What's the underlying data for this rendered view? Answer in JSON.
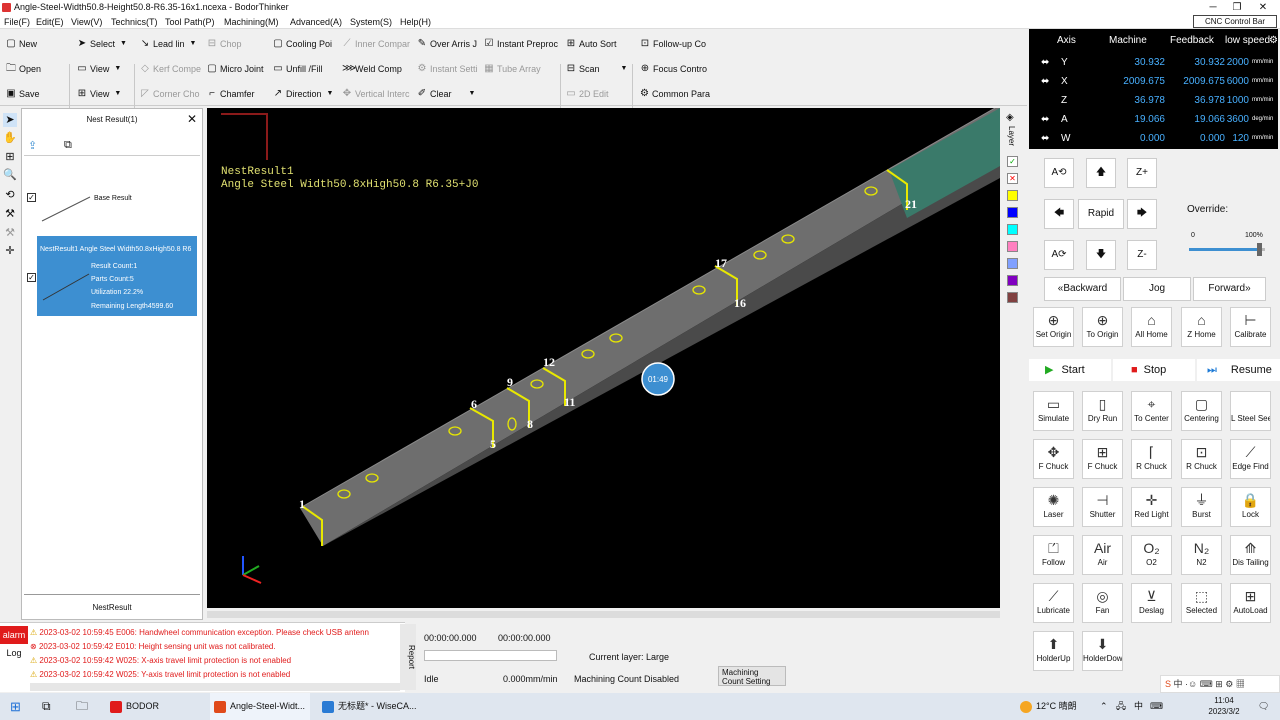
{
  "window": {
    "title": "Angle-Steel-Width50.8-Height50.8-R6.35-16x1.ncexa - BodorThinker"
  },
  "menu": [
    "File(F)",
    "Edit(E)",
    "View(V)",
    "Technics(T)",
    "Tool Path(P)",
    "Machining(M)",
    "Advanced(A)",
    "System(S)",
    "Help(H)"
  ],
  "cnc_bar": "CNC Control Bar",
  "toolbar": {
    "new": "New",
    "open": "Open",
    "save": "Save",
    "select": "Select",
    "view1": "View",
    "view2": "View",
    "lead_line": "Lead lin",
    "kerf_comp": "Kerf Compe",
    "corner_cho": "Corner Cho",
    "chop": "Chop",
    "micro_joint": "Micro Joint",
    "chamfer": "Chamfer",
    "cooling_point": "Cooling Poi",
    "unfill": "Unfill /Fill",
    "direction": "Direction",
    "inner_comp": "Inner Compar",
    "weld_comp": "Weld Comp",
    "vertical_inter": "Vertical Interc",
    "over_arris": "Over Arris J",
    "instant_sett": "Instant Setti",
    "clear": "Clear",
    "instant_preproc": "Instant Preproc",
    "tube_array": "Tube Array",
    "auto_sort": "Auto Sort",
    "scan": "Scan",
    "edit_2d": "2D Edit",
    "follow_up": "Follow-up Co",
    "focus_control": "Focus Contro",
    "common_para": "Common Para"
  },
  "nest_panel": {
    "title": "Nest Result(1)",
    "base_result": "Base Result",
    "result_title": "NestResult1 Angle Steel Width50.8xHigh50.8 R6",
    "result_count": "Result Count:1",
    "parts_count": "Parts Count:5",
    "utilization": "Utilization 22.2%",
    "remaining": "Remaining Length4599.60",
    "footer": "NestResult"
  },
  "canvas": {
    "label1": "NestResult1",
    "label2": "Angle Steel Width50.8xHigh50.8 R6.35+J0",
    "timer": "01:49",
    "part_numbers": [
      "1",
      "5",
      "6",
      "8",
      "9",
      "11",
      "12",
      "16",
      "17",
      "21"
    ]
  },
  "layer_label": "Layer",
  "layer_colors": [
    "#00aa00",
    "#ff0000",
    "#ffff00",
    "#0000ff",
    "#00ffff",
    "#ff80c0",
    "#80a0ff",
    "#8000c0",
    "#804040"
  ],
  "axis": {
    "headers": {
      "axis": "Axis",
      "machine": "Machine",
      "feedback": "Feedback",
      "speed": "low speed"
    },
    "rows": [
      {
        "name": "Y",
        "machine": "30.932",
        "feedback": "30.932",
        "speed": "2000",
        "unit": "mm/min"
      },
      {
        "name": "X",
        "machine": "2009.675",
        "feedback": "2009.675",
        "speed": "6000",
        "unit": "mm/min"
      },
      {
        "name": "Z",
        "machine": "36.978",
        "feedback": "36.978",
        "speed": "1000",
        "unit": "mm/min"
      },
      {
        "name": "A",
        "machine": "19.066",
        "feedback": "19.066",
        "speed": "3600",
        "unit": "deg/min"
      },
      {
        "name": "W",
        "machine": "0.000",
        "feedback": "0.000",
        "speed": "120",
        "unit": "mm/min"
      }
    ]
  },
  "jog": {
    "a_ccw": "A⟲",
    "z_plus": "Z+",
    "rapid": "Rapid",
    "a_cw": "A⟳",
    "z_minus": "Z-",
    "override_label": "Override:",
    "override_min": "0",
    "override_max": "100%",
    "override_value": 0.92
  },
  "move": {
    "backward": "Backward",
    "jog": "Jog",
    "forward": "Forward"
  },
  "home_buttons": [
    {
      "label": "Set Origin",
      "icon": "set-origin-icon",
      "glyph": "⊕"
    },
    {
      "label": "To Origin",
      "icon": "to-origin-icon",
      "glyph": "⊕"
    },
    {
      "label": "All Home",
      "icon": "all-home-icon",
      "glyph": "⌂"
    },
    {
      "label": "Z Home",
      "icon": "z-home-icon",
      "glyph": "⌂"
    },
    {
      "label": "Calibrate",
      "icon": "calibrate-icon",
      "glyph": "⊢"
    }
  ],
  "run": {
    "start": "Start",
    "stop": "Stop",
    "resume": "Resume"
  },
  "func_buttons": [
    {
      "label": "Simulate",
      "icon": "simulate-icon",
      "glyph": "▭"
    },
    {
      "label": "Dry Run",
      "icon": "dry-run-icon",
      "glyph": "▯"
    },
    {
      "label": "To Center",
      "icon": "to-center-icon",
      "glyph": "⌖"
    },
    {
      "label": "Centering",
      "icon": "centering-icon",
      "glyph": "▢"
    },
    {
      "label": "L Steel Seek Center(",
      "icon": "l-steel-seek-center-icon",
      "glyph": ""
    },
    {
      "label": "F Chuck",
      "icon": "f-chuck-open-icon",
      "glyph": "✥"
    },
    {
      "label": "F Chuck",
      "icon": "f-chuck-close-icon",
      "glyph": "⊞"
    },
    {
      "label": "R Chuck",
      "icon": "r-chuck-open-icon",
      "glyph": "⌈"
    },
    {
      "label": "R Chuck",
      "icon": "r-chuck-close-icon",
      "glyph": "⊡"
    },
    {
      "label": "Edge Find",
      "icon": "edge-find-icon",
      "glyph": "⟋"
    },
    {
      "label": "Laser",
      "icon": "laser-icon",
      "glyph": "✺"
    },
    {
      "label": "Shutter",
      "icon": "shutter-icon",
      "glyph": "⊣"
    },
    {
      "label": "Red Light",
      "icon": "red-light-icon",
      "glyph": "✛"
    },
    {
      "label": "Burst",
      "icon": "burst-icon",
      "glyph": "⏚"
    },
    {
      "label": "Lock",
      "icon": "lock-icon",
      "glyph": "🔒"
    },
    {
      "label": "Follow",
      "icon": "follow-icon",
      "glyph": "⏍"
    },
    {
      "label": "Air",
      "icon": "air-icon",
      "glyph": "Air"
    },
    {
      "label": "O2",
      "icon": "o2-icon",
      "glyph": "O₂"
    },
    {
      "label": "N2",
      "icon": "n2-icon",
      "glyph": "N₂"
    },
    {
      "label": "Dis Tailing",
      "icon": "dis-tailing-icon",
      "glyph": "⟰"
    },
    {
      "label": "Lubricate",
      "icon": "lubricate-icon",
      "glyph": "⟋"
    },
    {
      "label": "Fan",
      "icon": "fan-icon",
      "glyph": "◎"
    },
    {
      "label": "Deslag",
      "icon": "deslag-icon",
      "glyph": "⊻"
    },
    {
      "label": "Selected",
      "icon": "selected-icon",
      "glyph": "⬚"
    },
    {
      "label": "AutoLoad",
      "icon": "autoload-icon",
      "glyph": "⊞"
    },
    {
      "label": "HolderUp",
      "icon": "holder-up-icon",
      "glyph": "⬆"
    },
    {
      "label": "HolderDown",
      "icon": "holder-down-icon",
      "glyph": "⬇"
    }
  ],
  "alarms": {
    "tab_alarm": "alarm",
    "tab_log": "Log",
    "rows": [
      {
        "time": "2023-03-02 10:59:45",
        "msg": "E006: Handwheel communication exception. Please check USB antenn"
      },
      {
        "time": "2023-03-02 10:59:42",
        "msg": "E010: Height sensing unit was not calibrated."
      },
      {
        "time": "2023-03-02 10:59:42",
        "msg": "W025: X-axis travel limit protection is not enabled"
      },
      {
        "time": "2023-03-02 10:59:42",
        "msg": "W025: Y-axis travel limit protection is not enabled"
      }
    ]
  },
  "report": "Report",
  "status": {
    "time1": "00:00:00.000",
    "time2": "00:00:00.000",
    "current_layer": "Current layer: Large",
    "state": "Idle",
    "speed": "0.000mm/min",
    "machining_count": "Machining Count  Disabled",
    "mc_setting": "Machining Count Setting"
  },
  "taskbar": {
    "bodor": "BODOR",
    "task2": "Angle-Steel-Widt...",
    "task3": "无标题* - WiseCA...",
    "weather": "12°C 晴朗",
    "ime": "中",
    "time": "11:04",
    "date": "2023/3/2"
  }
}
